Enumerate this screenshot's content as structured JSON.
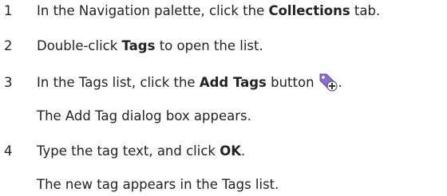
{
  "steps": [
    {
      "number": "1",
      "parts": [
        "In the Navigation palette, click the ",
        "Collections",
        " tab."
      ]
    },
    {
      "number": "2",
      "parts": [
        "Double-click ",
        "Tags",
        " to open the list."
      ]
    },
    {
      "number": "3",
      "parts": [
        "In the Tags list, click the ",
        "Add Tags",
        " button",
        "."
      ],
      "icon": "add-tag-icon",
      "result": "The Add Tag dialog box appears."
    },
    {
      "number": "4",
      "parts": [
        "Type the tag text, and click ",
        "OK",
        "."
      ],
      "result": "The new tag appears in the Tags list."
    }
  ],
  "colors": {
    "text": "#222222",
    "icon_tag": "#8a6ec9",
    "icon_plus_bg": "#ffffff"
  }
}
